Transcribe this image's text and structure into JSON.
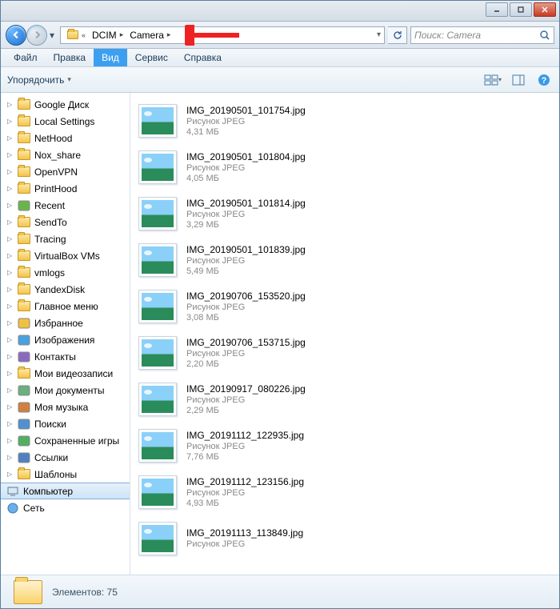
{
  "breadcrumb": {
    "lvl1": "DCIM",
    "lvl2": "Camera"
  },
  "search": {
    "placeholder": "Поиск: Camera"
  },
  "menu": {
    "file": "Файл",
    "edit": "Правка",
    "view": "Вид",
    "tools": "Сервис",
    "help": "Справка"
  },
  "cmdbar": {
    "organize": "Упорядочить"
  },
  "tree": {
    "items": [
      {
        "label": "Google Диск",
        "icon": "folder"
      },
      {
        "label": "Local Settings",
        "icon": "folder"
      },
      {
        "label": "NetHood",
        "icon": "folder"
      },
      {
        "label": "Nox_share",
        "icon": "folder"
      },
      {
        "label": "OpenVPN",
        "icon": "folder"
      },
      {
        "label": "PrintHood",
        "icon": "folder"
      },
      {
        "label": "Recent",
        "icon": "recent"
      },
      {
        "label": "SendTo",
        "icon": "folder"
      },
      {
        "label": "Tracing",
        "icon": "folder"
      },
      {
        "label": "VirtualBox VMs",
        "icon": "folder"
      },
      {
        "label": "vmlogs",
        "icon": "folder"
      },
      {
        "label": "YandexDisk",
        "icon": "folder"
      },
      {
        "label": "Главное меню",
        "icon": "folder"
      },
      {
        "label": "Избранное",
        "icon": "fav"
      },
      {
        "label": "Изображения",
        "icon": "pics"
      },
      {
        "label": "Контакты",
        "icon": "contacts"
      },
      {
        "label": "Мои видеозаписи",
        "icon": "folder"
      },
      {
        "label": "Мои документы",
        "icon": "docs"
      },
      {
        "label": "Моя музыка",
        "icon": "music"
      },
      {
        "label": "Поиски",
        "icon": "search"
      },
      {
        "label": "Сохраненные игры",
        "icon": "games"
      },
      {
        "label": "Ссылки",
        "icon": "links"
      },
      {
        "label": "Шаблоны",
        "icon": "folder"
      }
    ],
    "computer": "Компьютер",
    "network": "Сеть"
  },
  "files": [
    {
      "name": "IMG_20190501_101754.jpg",
      "type": "Рисунок JPEG",
      "size": "4,31 МБ"
    },
    {
      "name": "IMG_20190501_101804.jpg",
      "type": "Рисунок JPEG",
      "size": "4,05 МБ"
    },
    {
      "name": "IMG_20190501_101814.jpg",
      "type": "Рисунок JPEG",
      "size": "3,29 МБ"
    },
    {
      "name": "IMG_20190501_101839.jpg",
      "type": "Рисунок JPEG",
      "size": "5,49 МБ"
    },
    {
      "name": "IMG_20190706_153520.jpg",
      "type": "Рисунок JPEG",
      "size": "3,08 МБ"
    },
    {
      "name": "IMG_20190706_153715.jpg",
      "type": "Рисунок JPEG",
      "size": "2,20 МБ"
    },
    {
      "name": "IMG_20190917_080226.jpg",
      "type": "Рисунок JPEG",
      "size": "2,29 МБ"
    },
    {
      "name": "IMG_20191112_122935.jpg",
      "type": "Рисунок JPEG",
      "size": "7,76 МБ"
    },
    {
      "name": "IMG_20191112_123156.jpg",
      "type": "Рисунок JPEG",
      "size": "4,93 МБ"
    },
    {
      "name": "IMG_20191113_113849.jpg",
      "type": "Рисунок JPEG",
      "size": ""
    }
  ],
  "status": {
    "items_label": "Элементов:",
    "items_count": "75"
  }
}
